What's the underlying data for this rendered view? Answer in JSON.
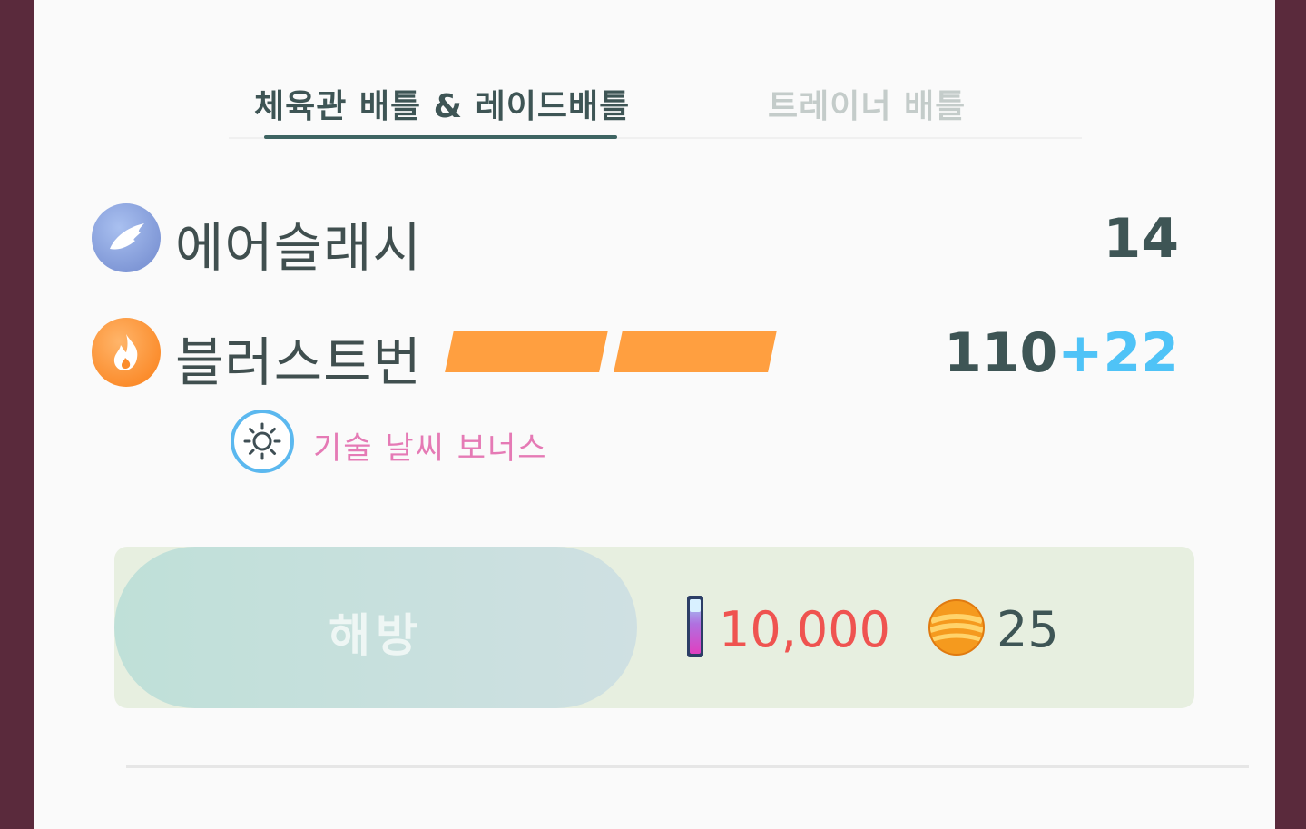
{
  "tabs": [
    {
      "label": "체육관 배틀 & 레이드배틀",
      "active": true
    },
    {
      "label": "트레이너 배틀",
      "active": false
    }
  ],
  "moves": [
    {
      "name": "에어슬래시",
      "type_icon": "flying-type-icon",
      "power": "14",
      "bonus": "",
      "energy_segments": 0
    },
    {
      "name": "블러스트번",
      "type_icon": "fire-type-icon",
      "power": "110",
      "bonus": "+22",
      "energy_segments": 2
    }
  ],
  "weather": {
    "icon": "sunny-weather-icon",
    "label": "기술 날씨 보너스"
  },
  "action": {
    "button_label": "해방",
    "stardust_icon": "stardust-icon",
    "stardust_cost": "10,000",
    "candy_icon": "candy-icon",
    "candy_cost": "25"
  },
  "colors": {
    "frame": "#5a2a3c",
    "fire": "#ff9f40",
    "flying": "#8aa8e0",
    "bonus": "#4fc3f7",
    "stardust_cost": "#ef5350",
    "weather_label": "#e57ab5"
  }
}
